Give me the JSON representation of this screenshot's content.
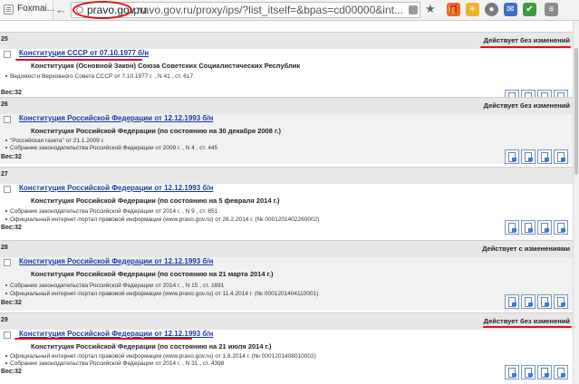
{
  "browser": {
    "tab_title": "Foxmai...",
    "url_domain": "pravo.gov.ru",
    "url_rest": "pravo.gov.ru/proxy/ips/?list_itself=&bpas=cd00000&int...",
    "back_glyph": "←",
    "star_glyph": "★",
    "extensions": [
      {
        "name": "gift-icon",
        "color": "#e46a2e",
        "glyph": "🎁"
      },
      {
        "name": "weather-icon",
        "color": "#f0b12a",
        "glyph": "☀"
      },
      {
        "name": "circle-icon",
        "color": "#7a7a7a",
        "glyph": "●"
      },
      {
        "name": "mail-icon",
        "color": "#3a6fc4",
        "glyph": "✉"
      },
      {
        "name": "shield-icon",
        "color": "#3c9b3c",
        "glyph": "✔"
      },
      {
        "name": "menu-icon",
        "color": "#8c8c8c",
        "glyph": "≡"
      }
    ]
  },
  "records": [
    {
      "num": "25",
      "status": "Действует без изменений",
      "link": "Конституция СССР от 07.10.1977 б/н",
      "subtitle": "Конституция (Основной Закон) Союза Советских Социалистических Республик",
      "sources": [
        "Ведомости Верховного Совета СССР от 7.10.1977 г. , N 41 , ст. 617"
      ],
      "weight": "Вес:32"
    },
    {
      "num": "26",
      "status": "Действует без изменений",
      "link": "Конституция Российской Федерации от 12.12.1993 б/н",
      "subtitle": "Конституция Российской Федерации (по состоянию на 30 декабря 2008 г.)",
      "sources": [
        "\"Российская газета\" от 21.1.2009 г.",
        "Собрание законодательства Российской Федерации от 2009 г. , N 4 , ст. 445"
      ],
      "weight": "Вес:32"
    },
    {
      "num": "27",
      "status": "",
      "link": "Конституция Российской Федерации от 12.12.1993 б/н",
      "subtitle": "Конституция Российской Федерации (по состоянию на 5 февраля 2014 г.)",
      "sources": [
        "Собрание законодательства Российской Федерации от 2014 г. , N 9 , ст. 851",
        "Официальный интернет-портал правовой информации (www.pravo.gov.ru) от 26.2.2014 г.  (№ 0001201402260002)"
      ],
      "weight": "Вес:32"
    },
    {
      "num": "28",
      "status": "Действует с изменениями",
      "link": "Конституция Российской Федерации от 12.12.1993 б/н",
      "subtitle": "Конституция Российской Федерации (по состоянию на 21 марта 2014 г.)",
      "sources": [
        "Собрание законодательства Российской Федерации от 2014 г. , N 15 , ст. 1691",
        "Официальный интернет-портал правовой информации (www.pravo.gov.ru) от 11.4.2014 г.  (№ 0001201404110001)"
      ],
      "weight": "Вес:32"
    },
    {
      "num": "29",
      "status": "Действует без изменений",
      "link": "Конституция Российской Федерации от 12.12.1993 б/н",
      "subtitle": "Конституция Российской Федерации (по состоянию на 21 июля 2014 г.)",
      "sources": [
        "Официальный интернет-портал правовой информации (www.pravo.gov.ru) от 1.8.2014 г.  (№ 0001201408010002)",
        "Собрание законодательства Российской Федерации от 2014 г. , N 31 , ст. 4398"
      ],
      "weight": "Вес:32"
    }
  ]
}
